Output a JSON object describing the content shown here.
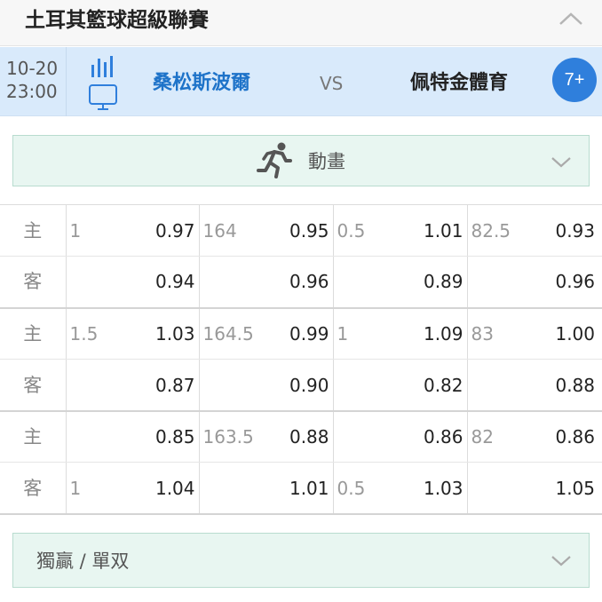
{
  "league": {
    "title": "土耳其籃球超級聯賽",
    "collapse_icon": "chevron-up-icon"
  },
  "match": {
    "date": "10-20",
    "time": "23:00",
    "home_team": "桑松斯波爾",
    "vs": "VS",
    "away_team": "佩特金體育",
    "more_markets": "7+",
    "icons": [
      "stats-icon",
      "tv-icon"
    ],
    "colors": {
      "highlight_bg": "#d9eafb",
      "home_team": "#1e73c9",
      "badge": "#2f7fdc"
    }
  },
  "animation": {
    "label": "動畫",
    "icon": "running-man-icon"
  },
  "odds": {
    "rows": [
      {
        "side": "主",
        "cells": [
          "1",
          "0.97",
          "164",
          "0.95",
          "0.5",
          "1.01",
          "82.5",
          "0.93"
        ]
      },
      {
        "side": "客",
        "cells": [
          "",
          "0.94",
          "",
          "0.96",
          "",
          "0.89",
          "",
          "0.96"
        ]
      },
      {
        "side": "主",
        "cells": [
          "1.5",
          "1.03",
          "164.5",
          "0.99",
          "1",
          "1.09",
          "83",
          "1.00"
        ]
      },
      {
        "side": "客",
        "cells": [
          "",
          "0.87",
          "",
          "0.90",
          "",
          "0.82",
          "",
          "0.88"
        ]
      },
      {
        "side": "主",
        "cells": [
          "",
          "0.85",
          "163.5",
          "0.88",
          "",
          "0.86",
          "82",
          "0.86"
        ]
      },
      {
        "side": "客",
        "cells": [
          "1",
          "1.04",
          "",
          "1.01",
          "0.5",
          "1.03",
          "",
          "1.05"
        ]
      }
    ]
  },
  "bet_section": {
    "label": "獨贏 / 單双",
    "icon": "chevron-down-icon"
  }
}
